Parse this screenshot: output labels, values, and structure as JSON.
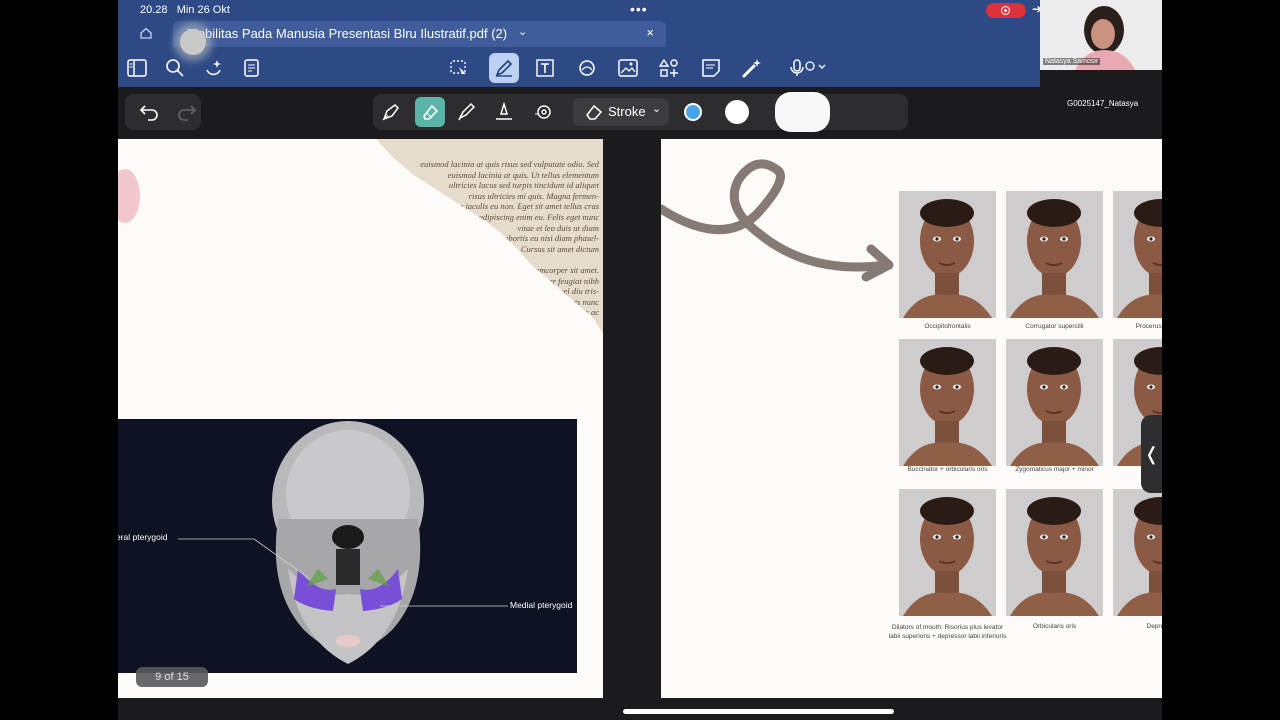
{
  "status_bar": {
    "time": "20.28",
    "date": "Min 26 Okt",
    "dots": "•••",
    "forward_arrow": "➔"
  },
  "document_tab": {
    "title": "Mobilitas Pada Manusia Presentasi Blru Ilustratif.pdf (2)",
    "close": "×",
    "chevron": "⌄"
  },
  "video_call": {
    "participant_name": "Natasya Samosir",
    "participant_id": "G0025147_Natasya"
  },
  "pen_toolbar": {
    "stroke_label": "Stroke",
    "stroke_chevron": "⌄"
  },
  "page_indicator": "9 of 15",
  "left_page": {
    "newspaper_lines": [
      "euismod lacinia at quis risus sed vulputate odio. Sed",
      "euismod lacinia at quis. Ut tellus elementum",
      "ultricies lacus sed turpis tincidunt id aliquet",
      "risus ultricies mi quis. Magna fermen-",
      "tum iaculis eu non. Eget sit amet tellus cras",
      "adipiscing enim eu. Felis eget nunc",
      "vitae et leo duis ut diam",
      "lobortis eu nisi diam phasel-",
      "lus. Cursus sit amet dictum",
      "",
      "ullamcorper sit amet.",
      "semper feugiat nibh",
      "sed vel diu tris-",
      "lique. Ut mauris nunc",
      "in fames ac",
      "mauris."
    ],
    "skull_labels": {
      "lateral": "eral pterygoid",
      "medial": "Medial pterygoid"
    }
  },
  "right_page": {
    "faces": [
      {
        "caption": "Occipitofrontalis"
      },
      {
        "caption": "Corrugator supercilii"
      },
      {
        "caption": "Procerus + part of"
      },
      {
        "caption": "Buccinator + orbicularis oris"
      },
      {
        "caption": "Zygomaticus major + minor"
      },
      {
        "caption": ""
      },
      {
        "caption": "Dilators of mouth: Risorius plus levator labii superioris + depressor labii inferioris"
      },
      {
        "caption": "Orbicularis oris"
      },
      {
        "caption": "Depressor"
      }
    ]
  },
  "collapse_tab": "❬"
}
